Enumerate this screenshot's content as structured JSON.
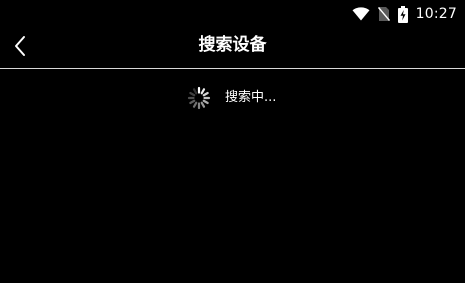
{
  "status_bar": {
    "time": "10:27",
    "icons": [
      "wifi-icon",
      "no-sim-icon",
      "battery-charging-icon"
    ]
  },
  "app_bar": {
    "back_icon": "chevron-left-icon",
    "title": "搜索设备"
  },
  "search_status": {
    "icon": "loading-spinner-icon",
    "text": "搜索中..."
  },
  "colors": {
    "background": "#000000",
    "foreground": "#ffffff",
    "divider": "#d8d8d8"
  }
}
